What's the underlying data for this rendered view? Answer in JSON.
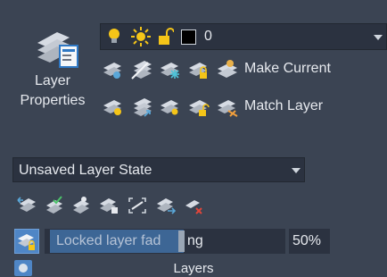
{
  "panel": {
    "title": "Layers",
    "colors": {
      "bg": "#3b4453",
      "field": "#2b3240",
      "accent": "#4f86c6",
      "tooltip": "#3f6b9f"
    }
  },
  "layer_properties": {
    "line1": "Layer",
    "line2": "Properties"
  },
  "layer_combo": {
    "value": "0",
    "icons": [
      "lightbulb-on-icon",
      "sun-thaw-icon",
      "padlock-unlocked-icon",
      "color-swatch-icon"
    ]
  },
  "row1": {
    "icons": [
      "layer-off-icon",
      "layer-isolate-icon",
      "layer-freeze-icon",
      "layer-lock-icon",
      "make-current-icon"
    ],
    "label": "Make Current"
  },
  "row2": {
    "icons": [
      "layer-on-icon",
      "layer-unisolate-icon",
      "thaw-all-icon",
      "layer-unlock-icon",
      "match-layer-icon"
    ],
    "label": "Match Layer"
  },
  "layer_state": {
    "value": "Unsaved Layer State"
  },
  "tools_row": {
    "icons": [
      "previous-icon",
      "layer-walk-icon",
      "change-to-current-icon",
      "copy-objects-icon",
      "layer-merge-icon",
      "copy-to-layer-icon",
      "layer-delete-icon"
    ]
  },
  "fade": {
    "icon": "locked-layer-fading-icon",
    "tooltip": "Locked layer fad",
    "trailing": "ng",
    "value": "50%"
  },
  "footer": {
    "icon": "layers-panel-icon"
  }
}
